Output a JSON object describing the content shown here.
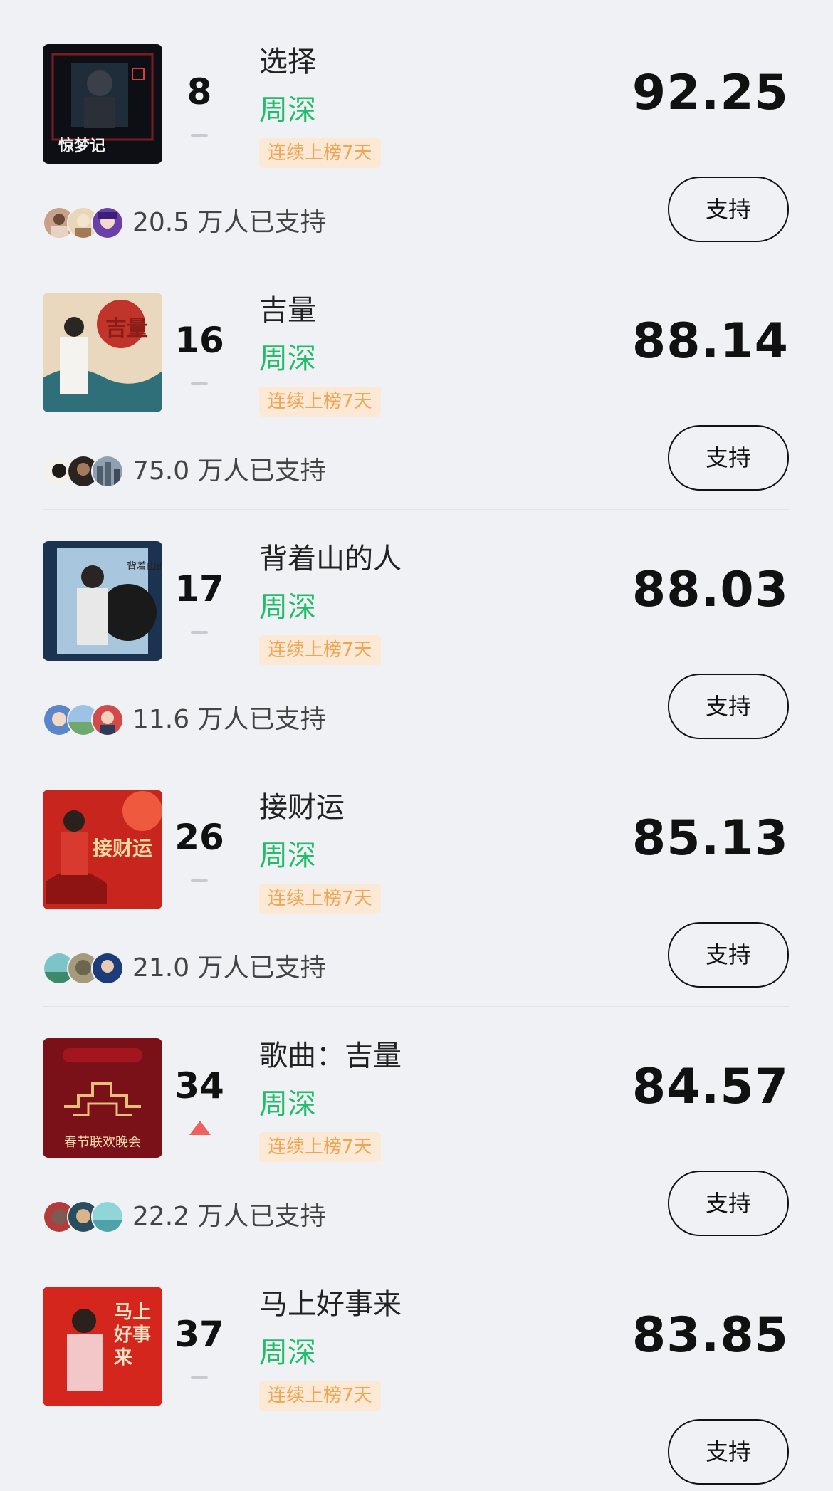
{
  "badge_text": "连续上榜7天",
  "support_label": "支持",
  "entries": [
    {
      "rank": "8",
      "trend": "flat",
      "song": "选择",
      "artist": "周深",
      "score": "92.25",
      "supporters": "20.5 万人已支持",
      "cover_text": "惊梦记",
      "cover_colors": [
        "#0d0f14",
        "#7a1d22",
        "#1f2d3b"
      ]
    },
    {
      "rank": "16",
      "trend": "flat",
      "song": "吉量",
      "artist": "周深",
      "score": "88.14",
      "supporters": "75.0 万人已支持",
      "cover_text": "吉量",
      "cover_colors": [
        "#c0342c",
        "#e9d8bd",
        "#2f6f7a"
      ]
    },
    {
      "rank": "17",
      "trend": "flat",
      "song": "背着山的人",
      "artist": "周深",
      "score": "88.03",
      "supporters": "11.6 万人已支持",
      "cover_text": "背着山的人",
      "cover_colors": [
        "#1b3350",
        "#a9c6df",
        "#e8e8e8"
      ]
    },
    {
      "rank": "26",
      "trend": "flat",
      "song": "接财运",
      "artist": "周深",
      "score": "85.13",
      "supporters": "21.0 万人已支持",
      "cover_text": "接财运",
      "cover_colors": [
        "#c8251f",
        "#ef5a3f",
        "#f2d9a0"
      ]
    },
    {
      "rank": "34",
      "trend": "up",
      "song": "歌曲：吉量",
      "artist": "周深",
      "score": "84.57",
      "supporters": "22.2 万人已支持",
      "cover_text": "春节联欢晚会",
      "cover_colors": [
        "#7a1118",
        "#e6c07a",
        "#a3161f"
      ]
    },
    {
      "rank": "37",
      "trend": "flat",
      "song": "马上好事来",
      "artist": "周深",
      "score": "83.85",
      "supporters": "",
      "cover_text": "马上好事来",
      "cover_colors": [
        "#d5261e",
        "#f3c7c7",
        "#f7e5c8"
      ]
    }
  ]
}
